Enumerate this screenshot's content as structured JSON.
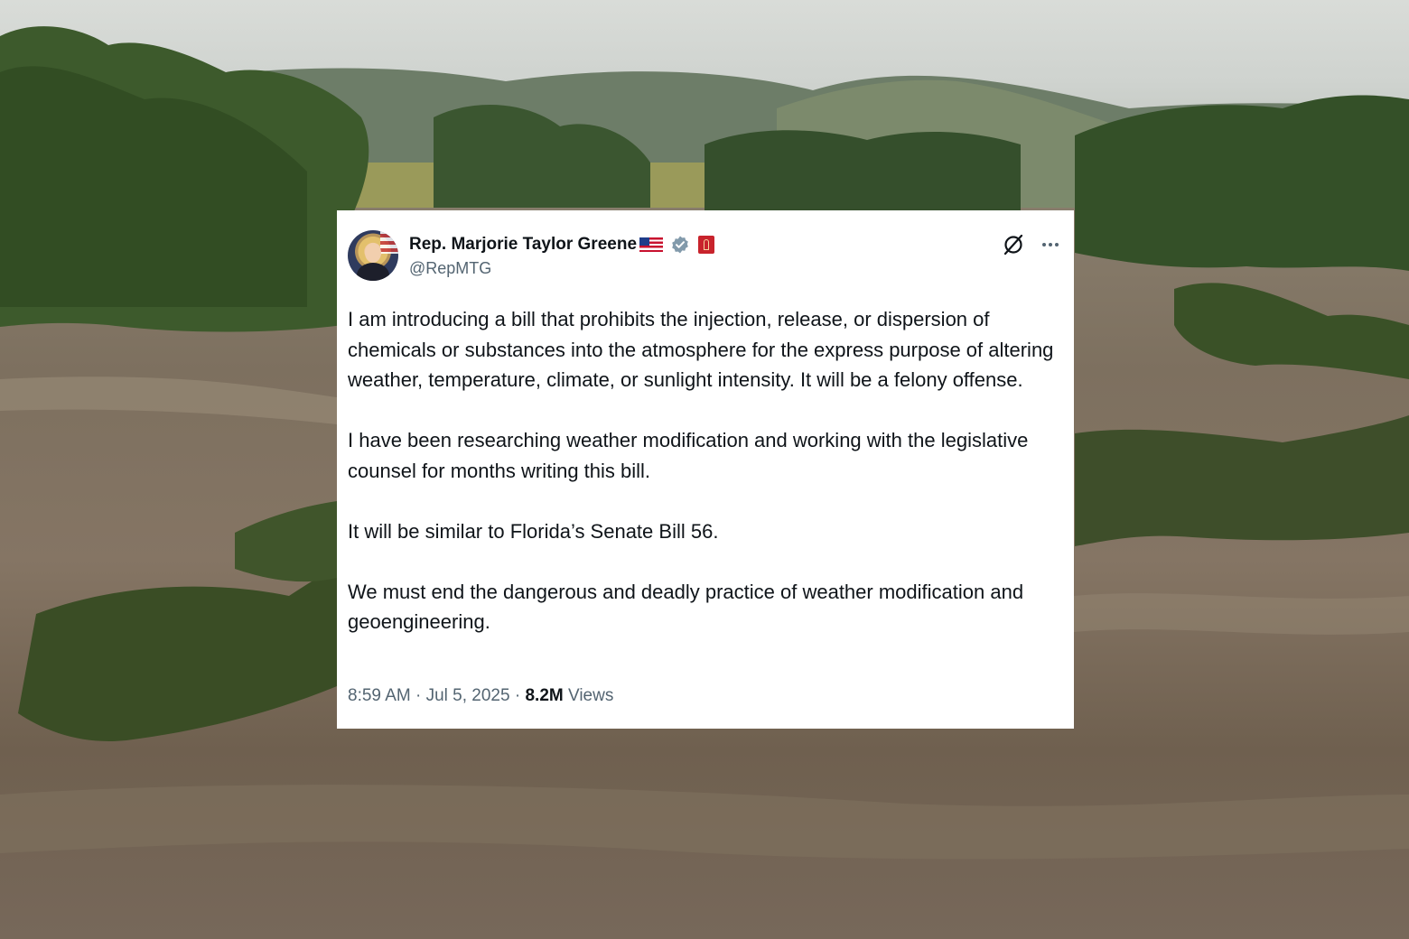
{
  "tweet": {
    "author_name": "Rep. Marjorie Taylor Greene",
    "handle": "@RepMTG",
    "paragraphs": [
      "I am introducing a bill that prohibits the injection, release, or dispersion of chemicals or substances into the atmosphere for the express purpose of altering weather, temperature, climate, or sunlight intensity. It will be a felony offense.",
      "I have been researching weather modification and working with the legislative counsel for months writing this bill.",
      "It will be similar to Florida’s Senate Bill 56.",
      "We must end the dangerous and deadly practice of weather modification and geoengineering."
    ],
    "time": "8:59 AM",
    "separator": "·",
    "date": "Jul 5, 2025",
    "views_count": "8.2M",
    "views_label": "Views"
  },
  "icons": {
    "flag": "us-flag-icon",
    "verified": "verified-badge-icon",
    "government": "government-badge-icon",
    "grok": "grok-icon",
    "more": "more-options-icon"
  },
  "colors": {
    "verified": "#829aab",
    "government_badge": "#c8232c",
    "text_primary": "#0f1419",
    "text_secondary": "#536471"
  }
}
